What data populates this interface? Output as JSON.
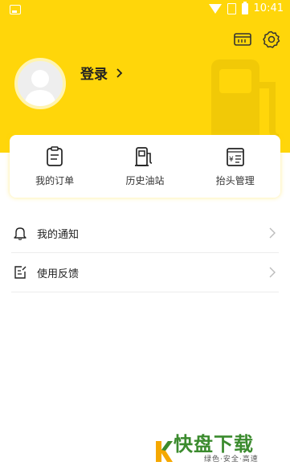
{
  "status_bar": {
    "time": "10:41"
  },
  "header": {
    "login_label": "登录",
    "background_color": "#ffd60a",
    "icons": [
      "wallet-icon",
      "settings-icon"
    ]
  },
  "quick_actions": [
    {
      "label": "我的订单",
      "icon": "order-icon"
    },
    {
      "label": "历史油站",
      "icon": "gas-station-icon"
    },
    {
      "label": "抬头管理",
      "icon": "invoice-icon"
    }
  ],
  "menu": [
    {
      "label": "我的通知",
      "icon": "bell-icon"
    },
    {
      "label": "使用反馈",
      "icon": "feedback-icon"
    }
  ],
  "watermark": {
    "brand": "快盘下载",
    "tagline": "绿色·安全·高速"
  }
}
